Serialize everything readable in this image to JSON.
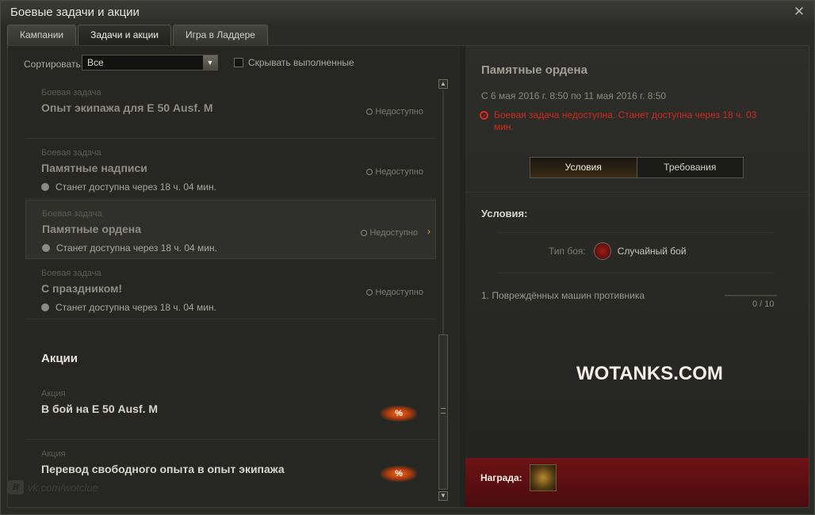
{
  "window": {
    "title": "Боевые задачи и акции"
  },
  "tabs": [
    "Кампании",
    "Задачи и акции",
    "Игра в Ладдере"
  ],
  "filter": {
    "sort_label": "Сортировать:",
    "sort_value": "Все",
    "hide_done_label": "Скрывать выполненные"
  },
  "quests": [
    {
      "type": "Боевая задача",
      "name": "Опыт экипажа для Е 50 Ausf. M",
      "status": "Недоступно",
      "avail": ""
    },
    {
      "type": "Боевая задача",
      "name": "Памятные надписи",
      "status": "Недоступно",
      "avail": "Станет доступна через 18 ч. 04 мин."
    },
    {
      "type": "Боевая задача",
      "name": "Памятные ордена",
      "status": "Недоступно",
      "avail": "Станет доступна через 18 ч. 04 мин.",
      "selected": true
    },
    {
      "type": "Боевая задача",
      "name": "С праздником!",
      "status": "Недоступно",
      "avail": "Станет доступна через 18 ч. 04 мин."
    }
  ],
  "actions_header": "Акции",
  "actions": [
    {
      "type": "Акция",
      "name": "В бой на Е 50 Ausf. M",
      "badge": "%"
    },
    {
      "type": "Акция",
      "name": "Перевод свободного опыта в опыт экипажа",
      "badge": "%"
    }
  ],
  "watermark": {
    "icon": "B",
    "text": "vk.com/wotclue"
  },
  "detail": {
    "title": "Памятные ордена",
    "dates": "С 6 мая 2016 г. 8:50 по 11 мая 2016 г. 8:50",
    "error": "Боевая задача недоступна. Станет доступна через 18 ч. 03 мин.",
    "subtabs": [
      "Условия",
      "Требования"
    ],
    "conditions_label": "Условия:",
    "battle_type_label": "Тип боя:",
    "battle_type_value": "Случайный бой",
    "condition": "1. Повреждённых машин противника",
    "progress": "0 / 10",
    "progress_fraction": 0,
    "site": "WOTANKS.COM",
    "reward_label": "Награда:"
  },
  "icons": {
    "close": "close-icon",
    "lock": "lock-icon",
    "clock": "clock-icon",
    "error": "error-icon",
    "battle": "battle-type-icon",
    "reward": "reward-icon",
    "vk": "vk-icon"
  },
  "colors": {
    "error": "#d22a1e",
    "accent": "#e6a53a",
    "reward_bg": "#6e1215"
  }
}
